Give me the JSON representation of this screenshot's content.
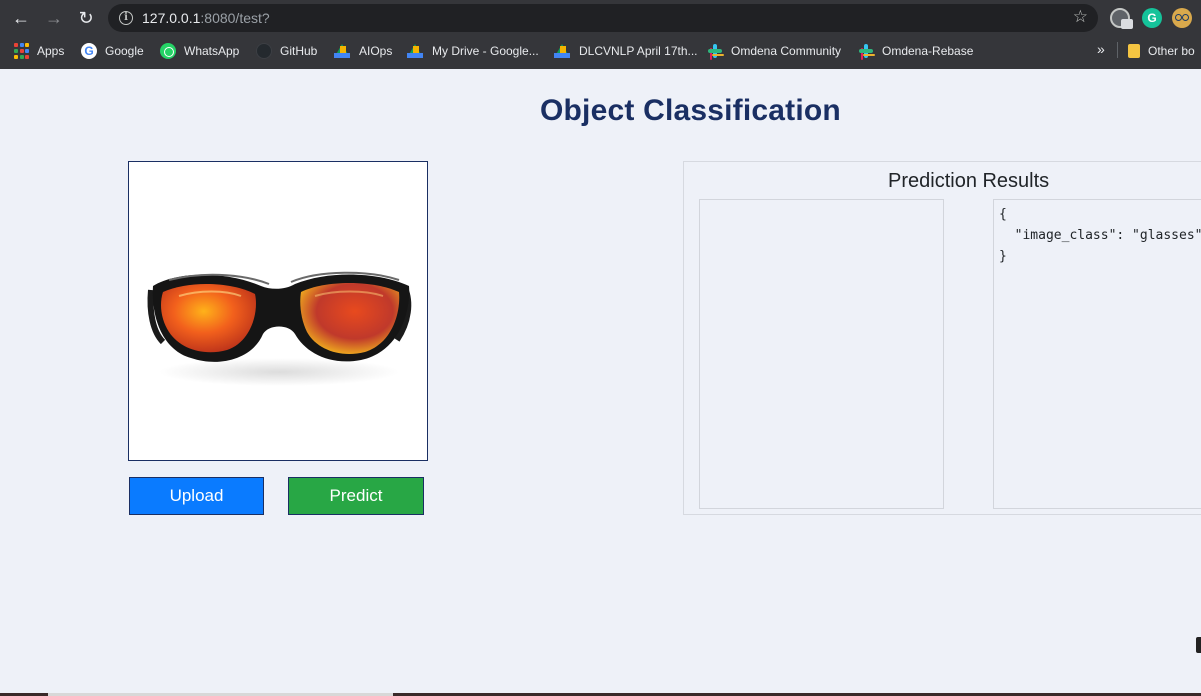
{
  "browser": {
    "url_host": "127.0.0.1",
    "url_rest": ":8080/test?",
    "bookmarks": [
      {
        "label": "Apps",
        "icon": "apps-grid-icon"
      },
      {
        "label": "Google",
        "icon": "google-icon"
      },
      {
        "label": "WhatsApp",
        "icon": "whatsapp-icon"
      },
      {
        "label": "GitHub",
        "icon": "github-icon"
      },
      {
        "label": "AIOps",
        "icon": "google-drive-icon"
      },
      {
        "label": "My Drive - Google...",
        "icon": "google-drive-icon"
      },
      {
        "label": "DLCVNLP April 17th...",
        "icon": "google-drive-icon"
      },
      {
        "label": "Omdena Community",
        "icon": "slack-icon"
      },
      {
        "label": "Omdena-Rebase",
        "icon": "slack-icon"
      }
    ],
    "other_bookmarks": "Other bo",
    "more_glyph": "»",
    "grammarly_letter": "G"
  },
  "page": {
    "title": "Object Classification",
    "upload_label": "Upload",
    "predict_label": "Predict",
    "results_title": "Prediction Results",
    "json_open": "{",
    "json_line": "  \"image_class\": \"glasses\"",
    "json_close": "}"
  },
  "colors": {
    "title": "#1a2f63",
    "upload": "#0a7bff",
    "predict": "#28a745",
    "page_bg": "#eef1f8"
  }
}
